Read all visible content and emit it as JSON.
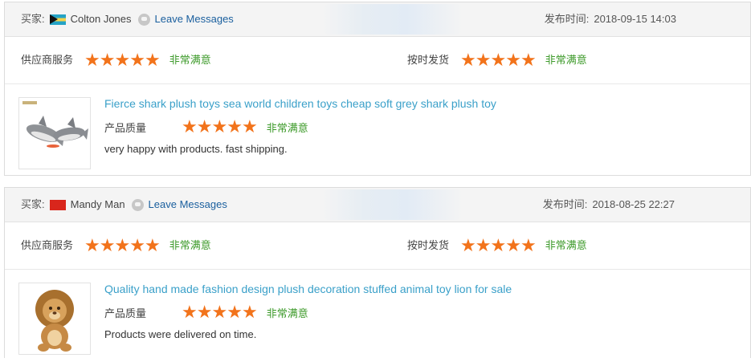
{
  "reviews": [
    {
      "buyer_label": "买家:",
      "flag": "bahamas-flag",
      "buyer_name": "Colton Jones",
      "leave_messages": "Leave Messages",
      "date_label": "发布时间:",
      "date": "2018-09-15 14:03",
      "supplier_service_label": "供应商服务",
      "supplier_service_stars": 5,
      "supplier_service_text": "非常满意",
      "on_time_label": "按时发货",
      "on_time_stars": 5,
      "on_time_text": "非常满意",
      "product_title": "Fierce shark plush toys sea world children toys cheap soft grey shark plush toy",
      "quality_label": "产品质量",
      "quality_stars": 5,
      "quality_text": "非常满意",
      "comment": "very happy with products. fast shipping.",
      "thumb_icon": "shark-plush-image"
    },
    {
      "buyer_label": "买家:",
      "flag": "hong-kong-flag",
      "buyer_name": "Mandy Man",
      "leave_messages": "Leave Messages",
      "date_label": "发布时间:",
      "date": "2018-08-25 22:27",
      "supplier_service_label": "供应商服务",
      "supplier_service_stars": 5,
      "supplier_service_text": "非常满意",
      "on_time_label": "按时发货",
      "on_time_stars": 5,
      "on_time_text": "非常满意",
      "product_title": "Quality hand made fashion design plush decoration stuffed animal toy lion for sale",
      "quality_label": "产品质量",
      "quality_stars": 5,
      "quality_text": "非常满意",
      "comment": "Products were delivered on time.",
      "thumb_icon": "lion-plush-image"
    }
  ],
  "colors": {
    "star": "#f2731b",
    "rating_text": "#3d9a2a",
    "title_link": "#3aa0c9",
    "buyer_link": "#1a5f9e"
  }
}
